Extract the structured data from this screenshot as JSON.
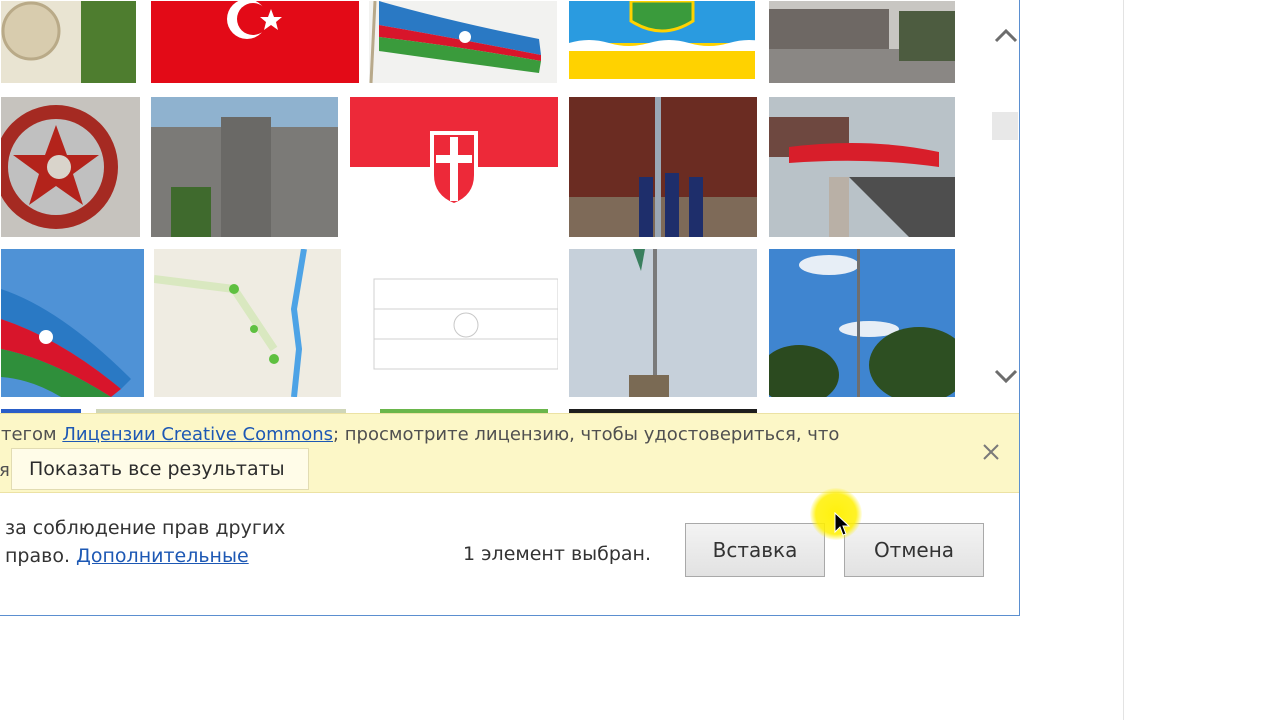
{
  "infobar": {
    "text_prefix": "тегом ",
    "license_link": "Лицензии Creative Commons",
    "text_suffix": "; просмотрите лицензию, чтобы удостовериться, что",
    "fragment": "я.",
    "show_all_button": "Показать все результаты",
    "close_icon": "close-icon"
  },
  "footer": {
    "line1": "за соблюдение прав других",
    "line2_prefix": "право. ",
    "more_link": "Дополнительные",
    "selected_count": "1 элемент выбран.",
    "insert_button": "Вставка",
    "cancel_button": "Отмена"
  },
  "scrollbar": {
    "up_icon": "chevron-up-icon",
    "down_icon": "chevron-down-icon"
  },
  "images": [
    "emblem-gold",
    "turkey-flag",
    "azerbaijan-flag-waving",
    "emblem-blue-yellow",
    "city-square",
    "red-order-star-medal",
    "soviet-building",
    "vienna-flag",
    "honor-guard",
    "parade-turkish-flags",
    "azerbaijan-flag-sky",
    "street-map",
    "emblem-line-drawing",
    "flagpole",
    "trees-sky-pole"
  ],
  "colors": {
    "accent": "#1d58b4",
    "infobar": "#fcf7c7",
    "cursor_highlight": "#fff000"
  }
}
